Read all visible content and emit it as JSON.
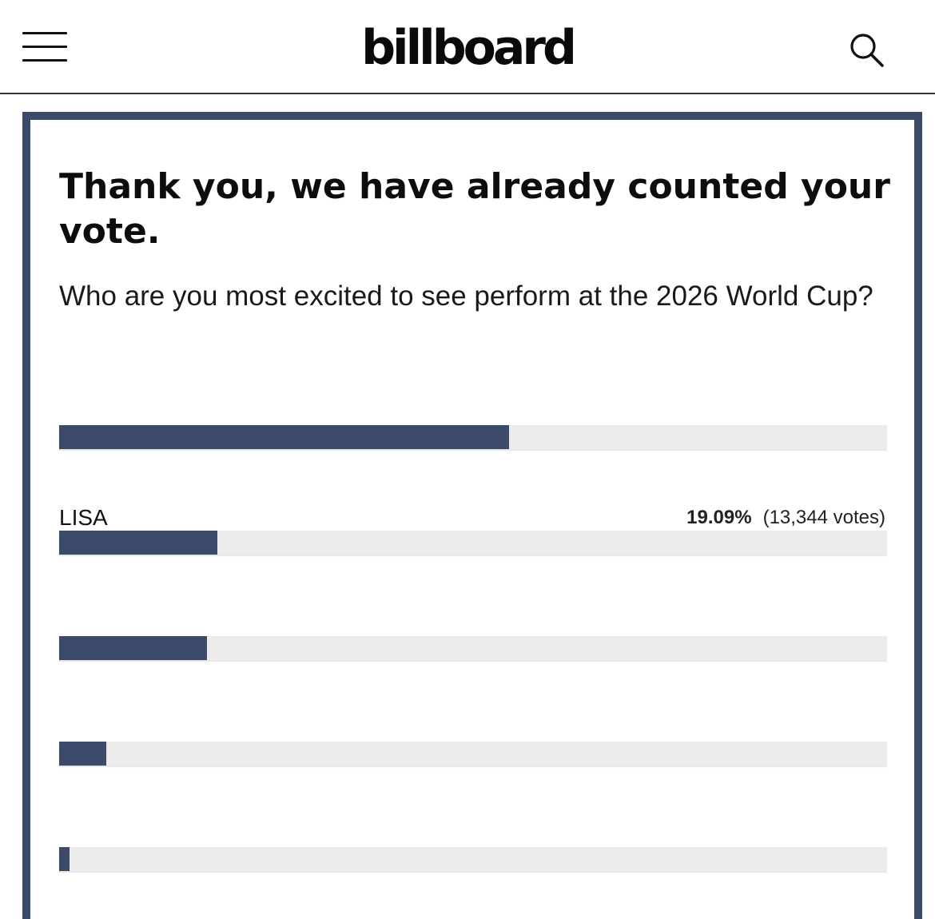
{
  "header": {
    "logo_text": "billboard",
    "menu_icon": "hamburger-menu-icon",
    "search_icon": "search-icon"
  },
  "poll": {
    "headline": "Thank you, we have already counted your vote.",
    "question": "Who are you most excited to see perform at the 2026 World Cup?",
    "accent_color": "#3b4a69",
    "track_color": "#ececec",
    "options": [
      {
        "label": "",
        "percent_text": "",
        "votes_text": "",
        "fill_fraction": 0.543
      },
      {
        "label": "LISA",
        "percent_text": "19.09%",
        "votes_text": "(13,344 votes)",
        "fill_fraction": 0.1909
      },
      {
        "label": "",
        "percent_text": "",
        "votes_text": "",
        "fill_fraction": 0.179
      },
      {
        "label": "",
        "percent_text": "",
        "votes_text": "",
        "fill_fraction": 0.057
      },
      {
        "label": "",
        "percent_text": "",
        "votes_text": "",
        "fill_fraction": 0.013
      }
    ]
  }
}
